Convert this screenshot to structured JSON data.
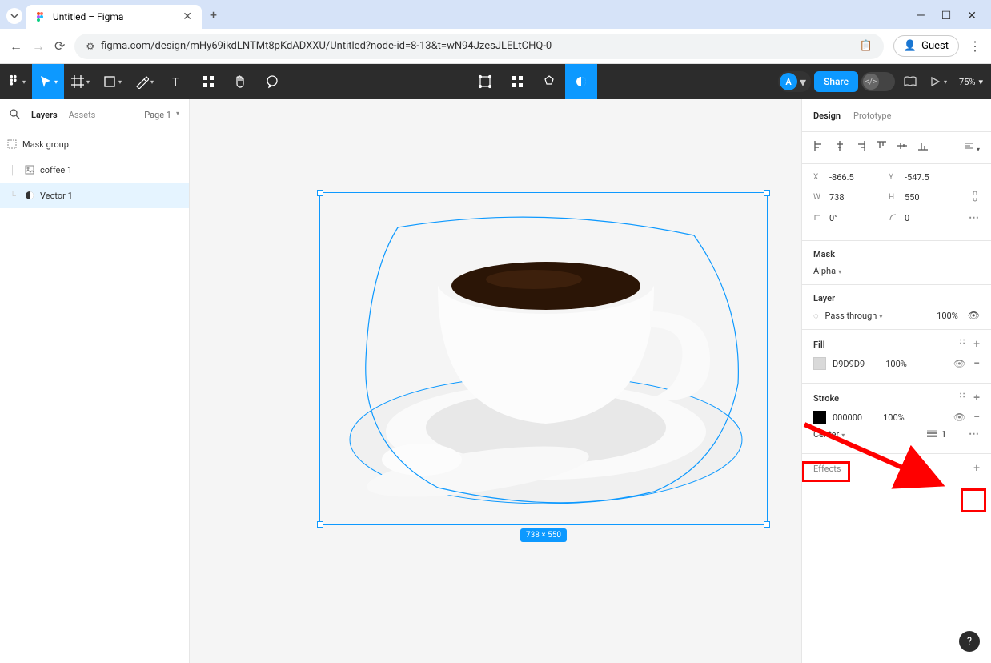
{
  "browser": {
    "tab_title": "Untitled – Figma",
    "url": "figma.com/design/mHy69ikdLNTMt8pKdADXXU/Untitled?node-id=8-13&t=wN94JzesJLELtCHQ-0",
    "guest_label": "Guest"
  },
  "toolbar": {
    "avatar_letter": "A",
    "share_label": "Share",
    "zoom": "75%"
  },
  "left_panel": {
    "tabs": {
      "layers": "Layers",
      "assets": "Assets"
    },
    "page_selector": "Page 1",
    "layers": [
      {
        "name": "Mask group",
        "type": "mask-group"
      },
      {
        "name": "coffee 1",
        "type": "image"
      },
      {
        "name": "Vector 1",
        "type": "vector",
        "selected": true
      }
    ]
  },
  "canvas": {
    "dimensions_label": "738 × 550"
  },
  "right_panel": {
    "tabs": {
      "design": "Design",
      "prototype": "Prototype"
    },
    "position": {
      "x": "-866.5",
      "y": "-547.5",
      "w": "738",
      "h": "550",
      "rotation": "0°",
      "radius": "0"
    },
    "mask": {
      "title": "Mask",
      "mode": "Alpha"
    },
    "layer": {
      "title": "Layer",
      "blend": "Pass through",
      "opacity": "100%"
    },
    "fill": {
      "title": "Fill",
      "color": "D9D9D9",
      "opacity": "100%"
    },
    "stroke": {
      "title": "Stroke",
      "color": "000000",
      "opacity": "100%",
      "align": "Center",
      "weight": "1"
    },
    "effects": {
      "title": "Effects"
    }
  }
}
